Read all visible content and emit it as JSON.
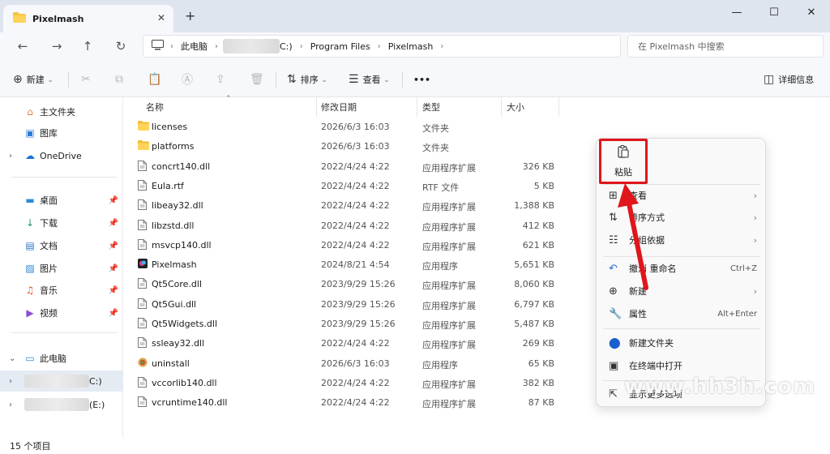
{
  "window": {
    "tab_title": "Pixelmash",
    "close_tab": "✕",
    "new_tab": "+",
    "minimize": "—",
    "maximize": "☐",
    "close": "✕"
  },
  "nav": {
    "back": "←",
    "forward": "→",
    "up": "↑",
    "refresh": "↻",
    "breadcrumbs": [
      "此电脑",
      "C:)",
      "Program Files",
      "Pixelmash"
    ],
    "search_placeholder": "在 Pixelmash 中搜索"
  },
  "toolbar": {
    "new_label": "新建",
    "sort_label": "排序",
    "view_label": "查看",
    "more_label": "•••",
    "details_label": "详细信息"
  },
  "sidebar": {
    "items": [
      {
        "label": "主文件夹",
        "icon": "home-icon"
      },
      {
        "label": "图库",
        "icon": "gallery-icon"
      },
      {
        "label": "OneDrive",
        "icon": "cloud-icon"
      },
      {
        "label": "桌面",
        "icon": "desktop-icon"
      },
      {
        "label": "下载",
        "icon": "download-icon"
      },
      {
        "label": "文档",
        "icon": "document-icon"
      },
      {
        "label": "图片",
        "icon": "picture-icon"
      },
      {
        "label": "音乐",
        "icon": "music-icon"
      },
      {
        "label": "视频",
        "icon": "video-icon"
      },
      {
        "label": "此电脑",
        "icon": "computer-icon"
      },
      {
        "label": "C:)",
        "icon": "drive-icon"
      },
      {
        "label": "(E:)",
        "icon": "drive-icon"
      }
    ]
  },
  "columns": {
    "name": "名称",
    "date": "修改日期",
    "type": "类型",
    "size": "大小"
  },
  "files": [
    {
      "name": "licenses",
      "date": "2026/6/3 16:03",
      "type": "文件夹",
      "size": "",
      "kind": "folder"
    },
    {
      "name": "platforms",
      "date": "2026/6/3 16:03",
      "type": "文件夹",
      "size": "",
      "kind": "folder"
    },
    {
      "name": "concrt140.dll",
      "date": "2022/4/24 4:22",
      "type": "应用程序扩展",
      "size": "326 KB",
      "kind": "file"
    },
    {
      "name": "Eula.rtf",
      "date": "2022/4/24 4:22",
      "type": "RTF 文件",
      "size": "5 KB",
      "kind": "file"
    },
    {
      "name": "libeay32.dll",
      "date": "2022/4/24 4:22",
      "type": "应用程序扩展",
      "size": "1,388 KB",
      "kind": "file"
    },
    {
      "name": "libzstd.dll",
      "date": "2022/4/24 4:22",
      "type": "应用程序扩展",
      "size": "412 KB",
      "kind": "file"
    },
    {
      "name": "msvcp140.dll",
      "date": "2022/4/24 4:22",
      "type": "应用程序扩展",
      "size": "621 KB",
      "kind": "file"
    },
    {
      "name": "Pixelmash",
      "date": "2024/8/21 4:54",
      "type": "应用程序",
      "size": "5,651 KB",
      "kind": "app"
    },
    {
      "name": "Qt5Core.dll",
      "date": "2023/9/29 15:26",
      "type": "应用程序扩展",
      "size": "8,060 KB",
      "kind": "file"
    },
    {
      "name": "Qt5Gui.dll",
      "date": "2023/9/29 15:26",
      "type": "应用程序扩展",
      "size": "6,797 KB",
      "kind": "file"
    },
    {
      "name": "Qt5Widgets.dll",
      "date": "2023/9/29 15:26",
      "type": "应用程序扩展",
      "size": "5,487 KB",
      "kind": "file"
    },
    {
      "name": "ssleay32.dll",
      "date": "2022/4/24 4:22",
      "type": "应用程序扩展",
      "size": "269 KB",
      "kind": "file"
    },
    {
      "name": "uninstall",
      "date": "2026/6/3 16:03",
      "type": "应用程序",
      "size": "65 KB",
      "kind": "uninstall"
    },
    {
      "name": "vccorlib140.dll",
      "date": "2022/4/24 4:22",
      "type": "应用程序扩展",
      "size": "382 KB",
      "kind": "file"
    },
    {
      "name": "vcruntime140.dll",
      "date": "2022/4/24 4:22",
      "type": "应用程序扩展",
      "size": "87 KB",
      "kind": "file"
    }
  ],
  "status": {
    "count": "15 个项目"
  },
  "context_menu": {
    "paste": "粘贴",
    "view": "查看",
    "sort": "排序方式",
    "group": "分组依据",
    "undo": "撤消 重命名",
    "undo_key": "Ctrl+Z",
    "new": "新建",
    "properties": "属性",
    "properties_key": "Alt+Enter",
    "new_folder": "新建文件夹",
    "terminal": "在终端中打开",
    "more": "显示更多选项"
  },
  "watermark": "www.hh3h.com",
  "colors": {
    "highlight": "#e0161b",
    "accent": "#0067c0"
  }
}
